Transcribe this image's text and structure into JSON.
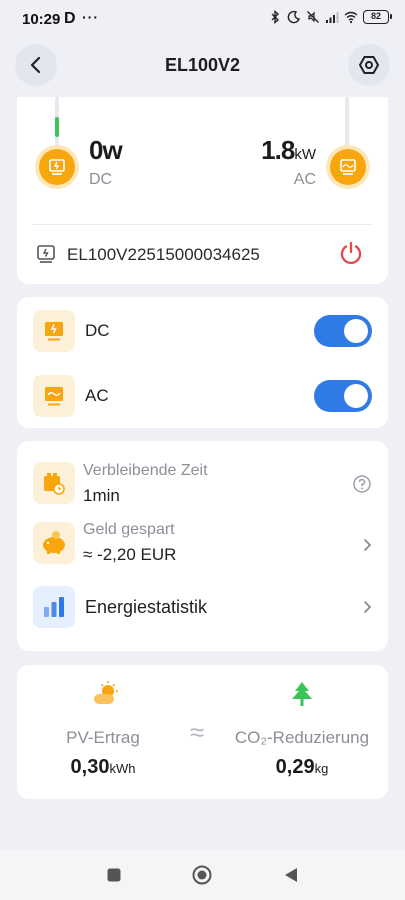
{
  "status_bar": {
    "time": "10:29",
    "carrier_glyph": "D",
    "dots": "···",
    "battery": "82",
    "icons": [
      "bluetooth-icon",
      "moon-icon",
      "mute-icon",
      "signal-icon",
      "wifi-icon",
      "battery-icon"
    ]
  },
  "header": {
    "title": "EL100V2",
    "back_icon": "chevron-left-icon",
    "settings_icon": "hexagon-settings-icon"
  },
  "flow": {
    "dc_value": "0w",
    "dc_label": "DC",
    "ac_value": "1.8",
    "ac_unit": "kW",
    "ac_label": "AC",
    "serial": "EL100V22515000034625"
  },
  "switches": [
    {
      "label": "DC",
      "on": true
    },
    {
      "label": "AC",
      "on": true
    }
  ],
  "info": {
    "remaining_label": "Verbleibende Zeit",
    "remaining_value": "1min",
    "saved_label": "Geld gespart",
    "saved_value": "≈ -2,20 EUR",
    "stats_title": "Energiestatistik"
  },
  "stats": {
    "pv_label": "PV-Ertrag",
    "pv_value": "0,30",
    "pv_unit": "kWh",
    "approx": "≈",
    "co2_label": "CO₂-Reduzierung",
    "co2_value": "0,29",
    "co2_unit": "kg"
  },
  "colors": {
    "accent": "#2f7ae5",
    "orange": "#f7a60e",
    "power_red": "#e5474f",
    "green": "#3bc45a"
  }
}
